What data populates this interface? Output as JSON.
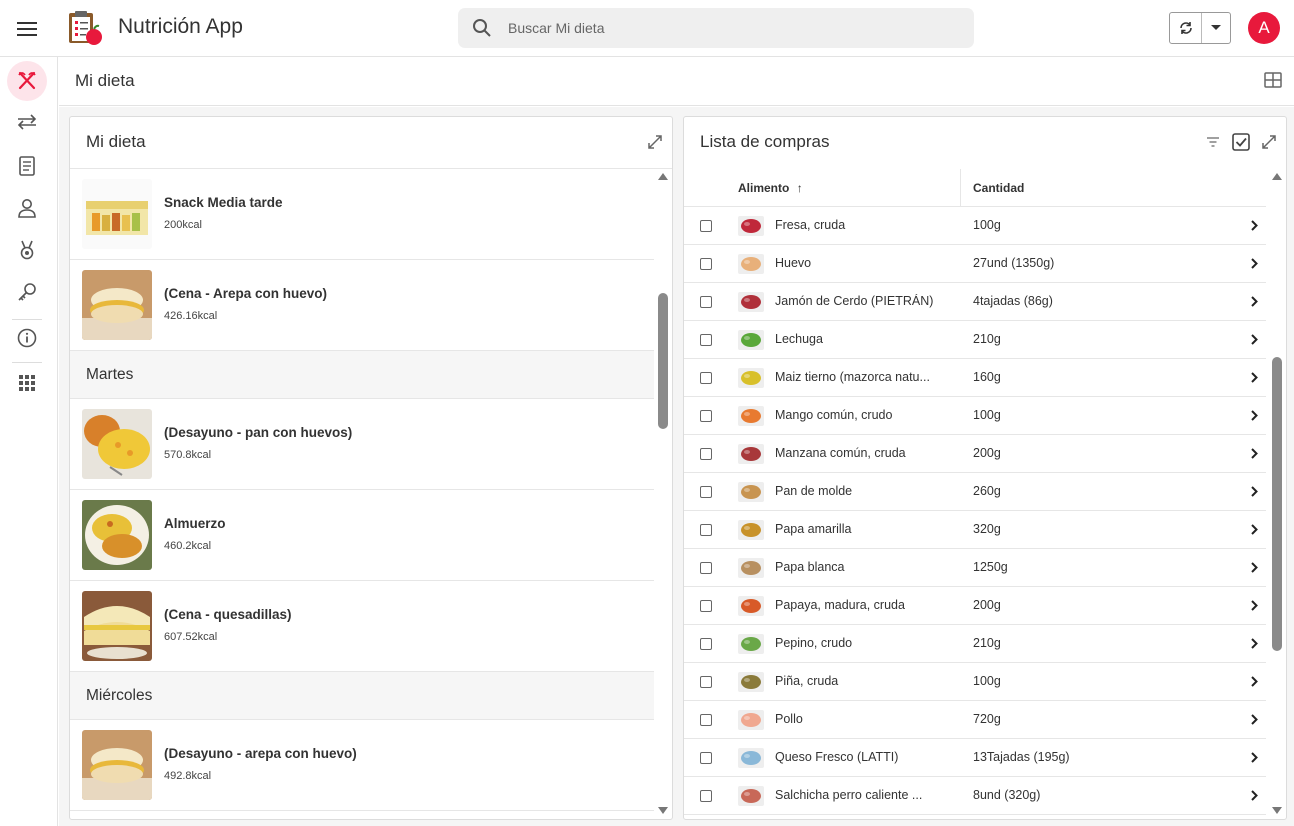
{
  "header": {
    "app_title": "Nutrición App",
    "search_placeholder": "Buscar Mi dieta",
    "avatar_initial": "A",
    "accent_color": "#e8193c"
  },
  "rail": {
    "items": [
      {
        "icon": "fork-knife-icon",
        "active": true
      },
      {
        "icon": "swap-icon"
      },
      {
        "icon": "book-icon"
      },
      {
        "icon": "person-icon"
      },
      {
        "icon": "medal-icon"
      },
      {
        "icon": "key-icon"
      },
      {
        "icon": "info-icon"
      },
      {
        "icon": "apps-grid-icon"
      }
    ]
  },
  "page": {
    "title": "Mi dieta"
  },
  "diet_card": {
    "title": "Mi dieta",
    "entries": [
      {
        "type": "meal",
        "name": "Snack Media tarde",
        "kcal": "200kcal",
        "image": "snack-package"
      },
      {
        "type": "meal",
        "name": "(Cena - Arepa con huevo)",
        "kcal": "426.16kcal",
        "image": "arepa"
      },
      {
        "type": "day",
        "label": "Martes"
      },
      {
        "type": "meal",
        "name": "(Desayuno - pan con huevos)",
        "kcal": "570.8kcal",
        "image": "bread-eggs"
      },
      {
        "type": "meal",
        "name": "Almuerzo",
        "kcal": "460.2kcal",
        "image": "lunch"
      },
      {
        "type": "meal",
        "name": "(Cena - quesadillas)",
        "kcal": "607.52kcal",
        "image": "quesadillas"
      },
      {
        "type": "day",
        "label": "Miércoles"
      },
      {
        "type": "meal",
        "name": "(Desayuno - arepa con huevo)",
        "kcal": "492.8kcal",
        "image": "arepa"
      }
    ]
  },
  "shopping_card": {
    "title": "Lista de compras",
    "columns": {
      "food": "Alimento",
      "qty": "Cantidad"
    },
    "sort_indicator": "↑",
    "rows": [
      {
        "name": "Fresa, cruda",
        "qty": "100g",
        "color": "#c0283a"
      },
      {
        "name": "Huevo",
        "qty": "27und (1350g)",
        "color": "#e8b07a"
      },
      {
        "name": "Jamón de Cerdo (PIETRÁN)",
        "qty": "4tajadas (86g)",
        "color": "#b0303a"
      },
      {
        "name": "Lechuga",
        "qty": "210g",
        "color": "#5aa83a"
      },
      {
        "name": "Maiz tierno (mazorca natu...",
        "qty": "160g",
        "color": "#d8c02a"
      },
      {
        "name": "Mango común, crudo",
        "qty": "100g",
        "color": "#e87a30"
      },
      {
        "name": "Manzana común, cruda",
        "qty": "200g",
        "color": "#a8383a"
      },
      {
        "name": "Pan de molde",
        "qty": "260g",
        "color": "#c89450"
      },
      {
        "name": "Papa amarilla",
        "qty": "320g",
        "color": "#c8922a"
      },
      {
        "name": "Papa blanca",
        "qty": "1250g",
        "color": "#b89060"
      },
      {
        "name": "Papaya, madura, cruda",
        "qty": "200g",
        "color": "#d85a28"
      },
      {
        "name": "Pepino, crudo",
        "qty": "210g",
        "color": "#6aa848"
      },
      {
        "name": "Piña, cruda",
        "qty": "100g",
        "color": "#8a7a3a"
      },
      {
        "name": "Pollo",
        "qty": "720g",
        "color": "#f0a890"
      },
      {
        "name": "Queso Fresco (LATTI)",
        "qty": "13Tajadas (195g)",
        "color": "#8ab8d8"
      },
      {
        "name": "Salchicha perro caliente ...",
        "qty": "8und (320g)",
        "color": "#c86858"
      }
    ]
  }
}
